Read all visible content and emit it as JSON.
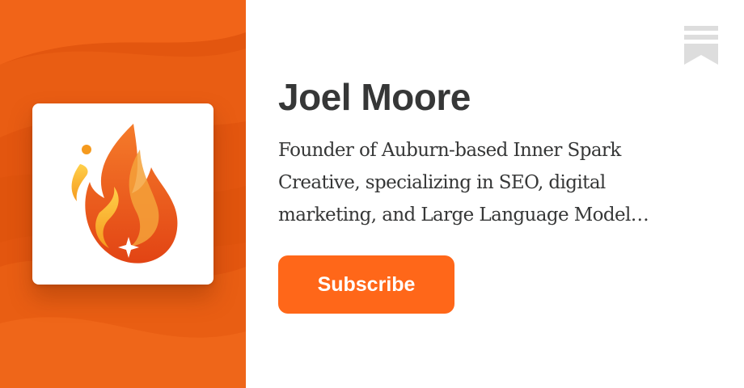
{
  "profile": {
    "name": "Joel Moore",
    "bio_lines": [
      "Founder of Auburn-based Inner Spark",
      "Creative, specializing in SEO, digital",
      "marketing, and Large Language Model…"
    ]
  },
  "actions": {
    "subscribe_label": "Subscribe"
  },
  "icons": {
    "logo": "flame-logo-icon",
    "bookmark": "substack-bookmark-icon"
  },
  "colors": {
    "accent": "#ff6719",
    "panel_background": "#e85a14",
    "title_text": "#363737",
    "bookmark": "#dddddd"
  }
}
